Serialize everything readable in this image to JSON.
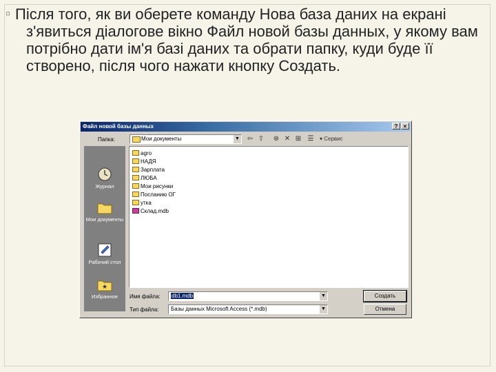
{
  "slide": {
    "paragraph": "Після того, як ви оберете команду Нова база даних на екрані з'явиться діалогове вікно Файл новой базы данных, у якому вам потрібно дати ім'я базі даних та обрати папку, куди буде її створено, після чого нажати кнопку Создать."
  },
  "dialog": {
    "title": "Файл новой базы данных",
    "help_label": "?",
    "close_label": "×",
    "folder_label": "Папка:",
    "folder_value": "Мои документы",
    "service_label": "Сервис",
    "places": [
      {
        "label": "Журнал",
        "icon": "history-icon"
      },
      {
        "label": "Мои документы",
        "icon": "my-documents-icon"
      },
      {
        "label": "Рабочий стол",
        "icon": "desktop-icon"
      },
      {
        "label": "Избранное",
        "icon": "favorites-icon"
      }
    ],
    "files": [
      {
        "name": "agro",
        "type": "folder"
      },
      {
        "name": "НАДЯ",
        "type": "folder"
      },
      {
        "name": "Зарплата",
        "type": "folder"
      },
      {
        "name": "ЛЮБА",
        "type": "folder"
      },
      {
        "name": "Мои рисунки",
        "type": "folder"
      },
      {
        "name": "Посланию ОГ",
        "type": "folder"
      },
      {
        "name": "утка",
        "type": "folder"
      },
      {
        "name": "Склад.mdb",
        "type": "database"
      }
    ],
    "filename_label": "Имя файла:",
    "filename_value": "db1.mdb",
    "filetype_label": "Тип файла:",
    "filetype_value": "Базы данных Microsoft Access (*.mdb)",
    "create_button": "Создать",
    "cancel_button": "Отмена"
  }
}
